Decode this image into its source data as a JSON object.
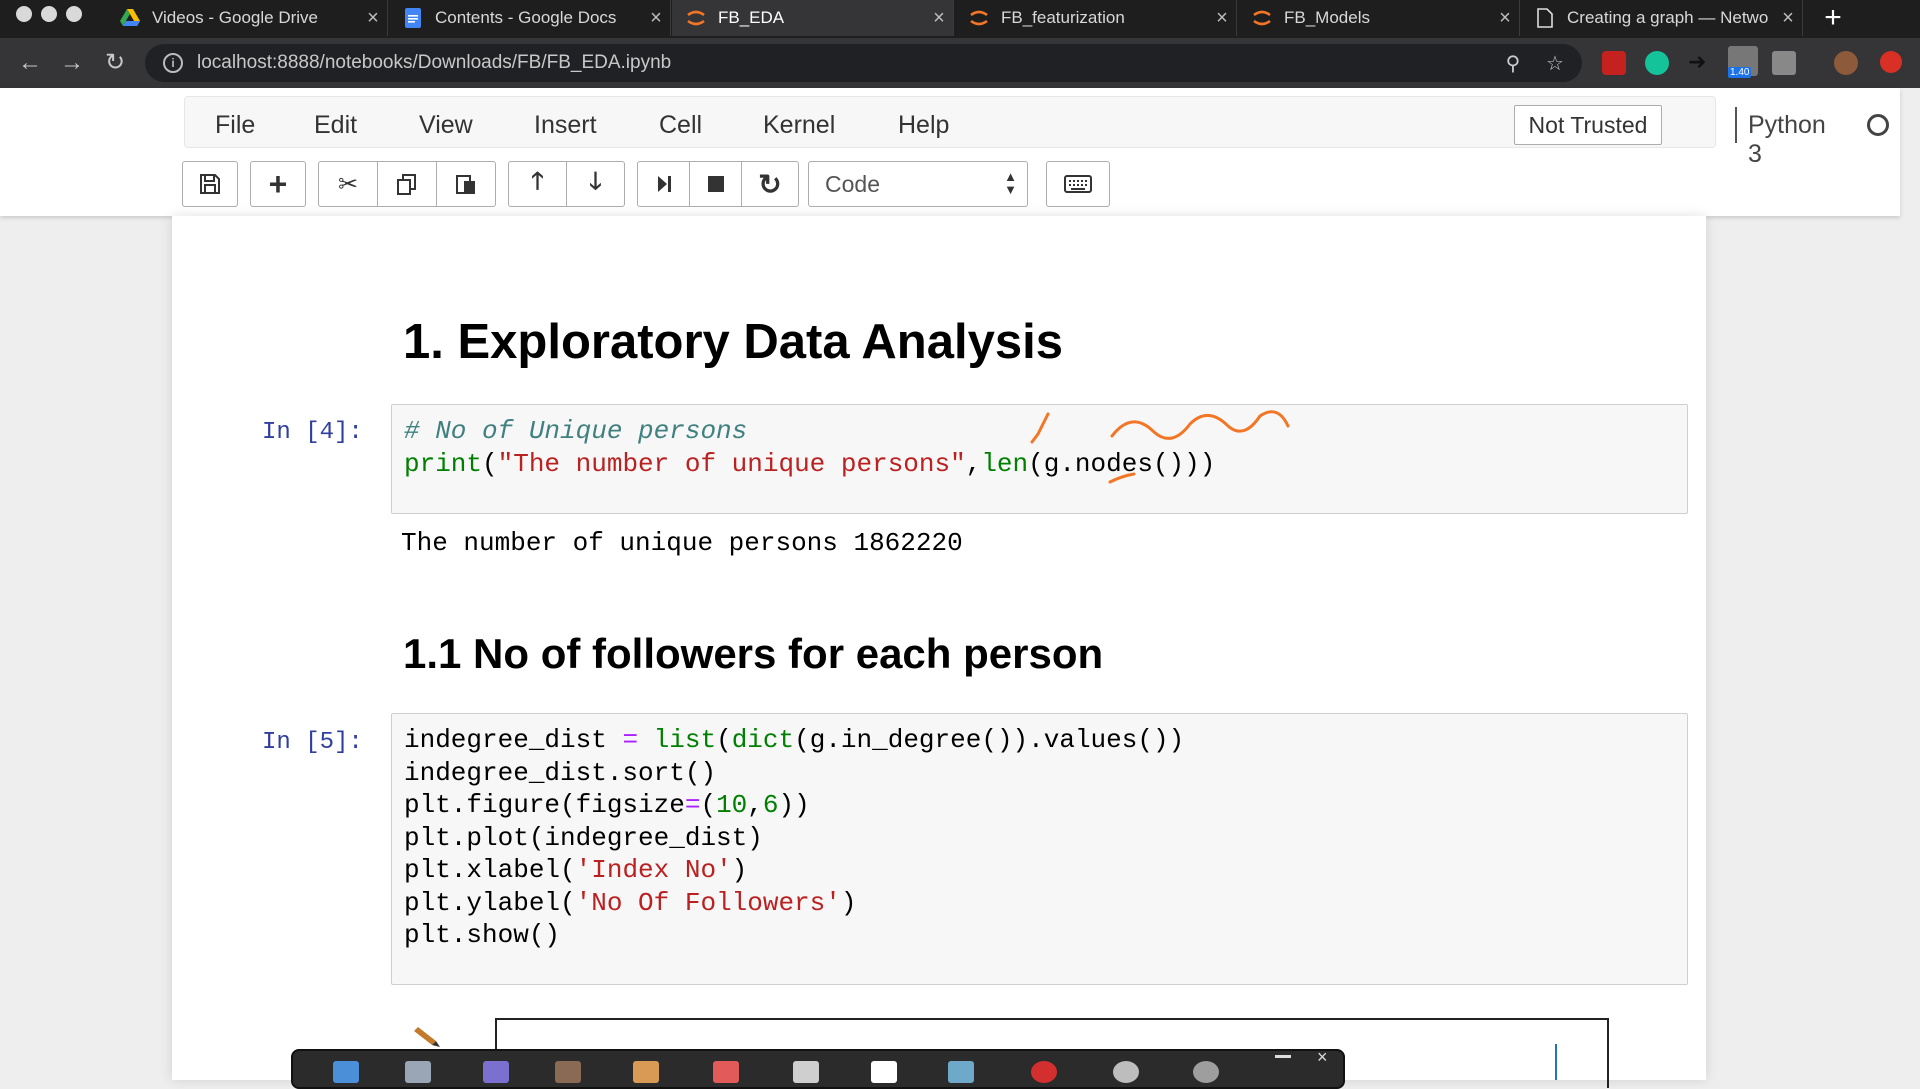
{
  "browser": {
    "tabs": [
      {
        "title": "Videos - Google Drive",
        "icon": "google-drive-icon",
        "active": false
      },
      {
        "title": "Contents - Google Docs",
        "icon": "google-docs-icon",
        "active": false
      },
      {
        "title": "FB_EDA",
        "icon": "jupyter-icon",
        "active": true
      },
      {
        "title": "FB_featurization",
        "icon": "jupyter-icon",
        "active": false
      },
      {
        "title": "FB_Models",
        "icon": "jupyter-icon",
        "active": false
      },
      {
        "title": "Creating a graph — Netwo",
        "icon": "document-icon",
        "active": false
      }
    ],
    "url": "localhost:8888/notebooks/Downloads/FB/FB_EDA.ipynb",
    "extension_badge": "1.40"
  },
  "jupyter": {
    "menu": [
      "File",
      "Edit",
      "View",
      "Insert",
      "Cell",
      "Kernel",
      "Help"
    ],
    "trusted_label": "Not Trusted",
    "kernel_name": "Python 3",
    "cell_type": "Code"
  },
  "notebook": {
    "heading1": "1. Exploratory Data Analysis",
    "cell1": {
      "prompt": "In [4]:",
      "comment": "# No of Unique persons",
      "line2": {
        "fn_print": "print",
        "p_open": "(",
        "str": "\"The number of unique persons\"",
        "comma": ",",
        "fn_len": "len",
        "rest": "(g.nodes()))"
      },
      "output": "The number of unique persons 1862220"
    },
    "heading2": "1.1 No of followers for each person",
    "cell2": {
      "prompt": "In [5]:",
      "l1": {
        "a": "indegree_dist ",
        "eq": "=",
        "b": " ",
        "list": "list",
        "c": "(",
        "dict": "dict",
        "d": "(g.in_degree()).values())"
      },
      "l2": "indegree_dist.sort()",
      "l3": {
        "a": "plt.figure(figsize",
        "eq": "=",
        "b": "(",
        "n1": "10",
        "c": ",",
        "n2": "6",
        "d": "))"
      },
      "l4": "plt.plot(indegree_dist)",
      "l5": {
        "a": "plt.xlabel(",
        "s": "'Index No'",
        "b": ")"
      },
      "l6": {
        "a": "plt.ylabel(",
        "s": "'No Of Followers'",
        "b": ")"
      },
      "l7": "plt.show()"
    }
  },
  "colors": {
    "accent_orange": "#f37626",
    "prompt_blue": "#303f9f",
    "string_red": "#ba2121",
    "builtin_green": "#008000"
  }
}
